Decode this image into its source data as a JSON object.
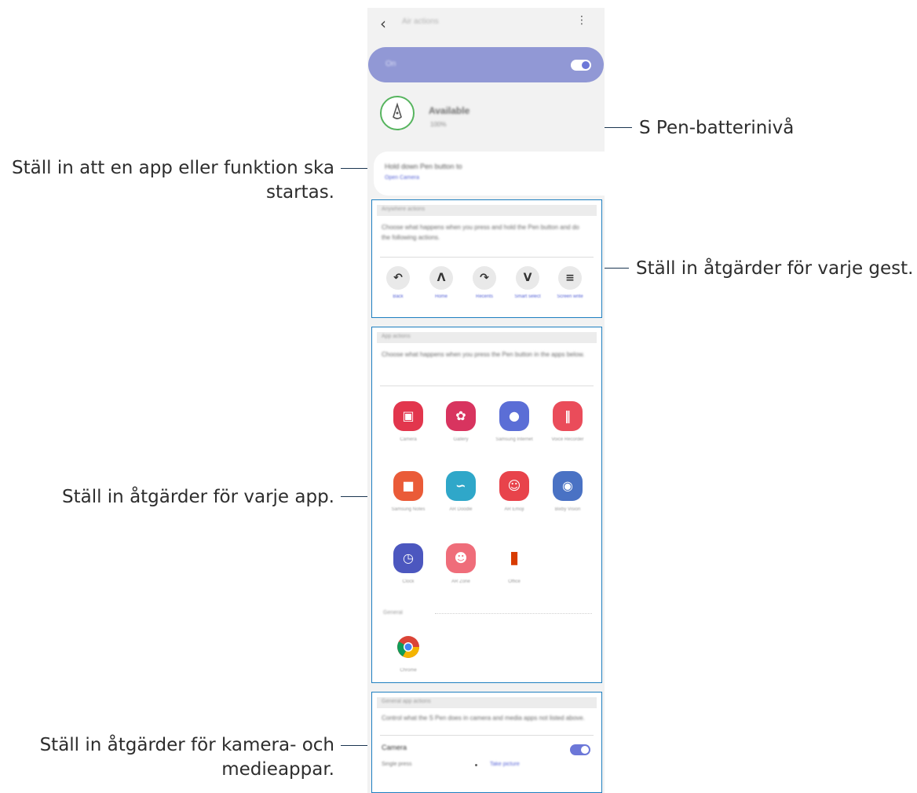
{
  "callouts": {
    "battery": "S Pen-batterinivå",
    "hold_line1": "Ställ in att en app eller funktion ska",
    "hold_line2": "startas.",
    "gesture": "Ställ in åtgärder för varje gest.",
    "app": "Ställ in åtgärder för varje app.",
    "media_line1": "Ställ in åtgärder för kamera- och",
    "media_line2": "medieappar."
  },
  "screen": {
    "title": "Air actions",
    "master_toggle": {
      "label": "On",
      "state": "on"
    },
    "pen_status": {
      "status": "Available",
      "battery": "100%",
      "ring_color": "#56b45e"
    },
    "hold": {
      "title": "Hold down Pen button to",
      "value": "Open Camera"
    },
    "gestures": {
      "header": "Anywhere actions",
      "description": "Choose what happens when you press and hold the Pen button and do the following actions.",
      "items": [
        {
          "label": "Back",
          "icon": "gesture-back-icon"
        },
        {
          "label": "Home",
          "icon": "gesture-home-icon"
        },
        {
          "label": "Recents",
          "icon": "gesture-recents-icon"
        },
        {
          "label": "Smart select",
          "icon": "gesture-smart-select-icon"
        },
        {
          "label": "Screen write",
          "icon": "gesture-screen-write-icon"
        }
      ]
    },
    "apps": {
      "header": "App actions",
      "description": "Choose what happens when you press the Pen button in the apps below.",
      "items": [
        {
          "label": "Camera",
          "icon": "camera-icon",
          "color": "#e2364d"
        },
        {
          "label": "Gallery",
          "icon": "gallery-icon",
          "color": "#d8345f"
        },
        {
          "label": "Samsung Internet",
          "icon": "samsung-internet-icon",
          "color": "#5b6ed6"
        },
        {
          "label": "Voice Recorder",
          "icon": "voice-recorder-icon",
          "color": "#ea4c5a"
        },
        {
          "label": "Samsung Notes",
          "icon": "samsung-notes-icon",
          "color": "#ea5b38"
        },
        {
          "label": "AR Doodle",
          "icon": "ar-doodle-icon",
          "color": "#2fa7c9"
        },
        {
          "label": "AR Emoji",
          "icon": "ar-emoji-icon",
          "color": "#e8434b"
        },
        {
          "label": "Bixby Vision",
          "icon": "bixby-vision-icon",
          "color": "#4a72c4"
        },
        {
          "label": "Clock",
          "icon": "clock-icon",
          "color": "#4c57bf"
        },
        {
          "label": "AR Zone",
          "icon": "ar-zone-icon",
          "color": "#ef6d7a"
        },
        {
          "label": "Office",
          "icon": "office-icon",
          "color": "#d83b01"
        }
      ],
      "general_header": "General",
      "general_items": [
        {
          "label": "Chrome",
          "icon": "chrome-icon"
        }
      ]
    },
    "camera_media": {
      "header": "General app actions",
      "description": "Control what the S Pen does in camera and media apps not listed above.",
      "camera_label": "Camera",
      "camera_toggle": "on",
      "single_press_label": "Single press",
      "single_press_value": "Take picture"
    }
  }
}
